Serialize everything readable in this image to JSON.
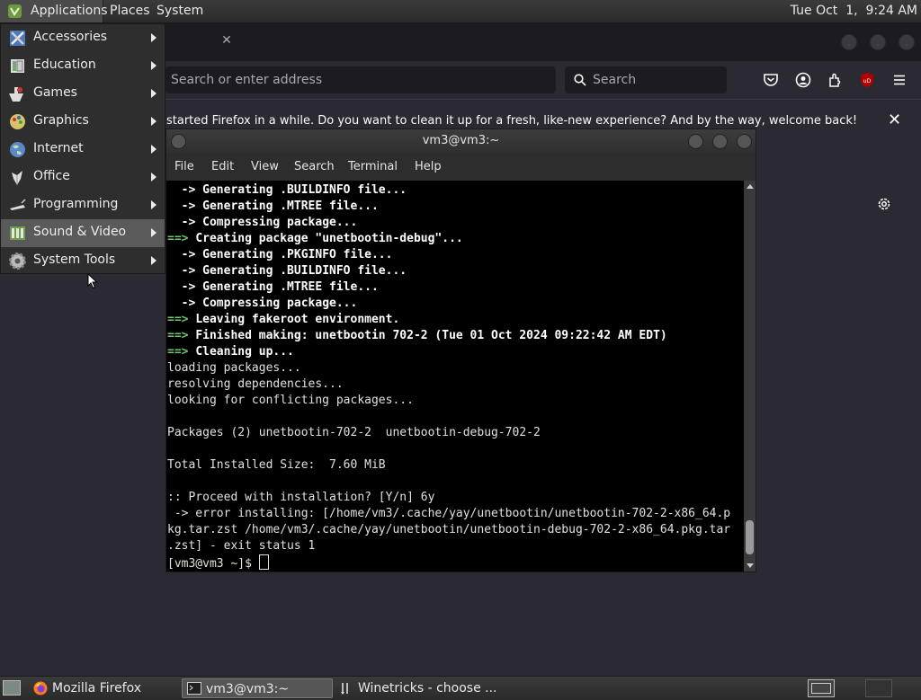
{
  "top_panel": {
    "applications_label": "Applications",
    "places_label": "Places",
    "system_label": "System",
    "clock": "Tue Oct  1,  9:24 AM"
  },
  "firefox": {
    "url_placeholder": "Search or enter address",
    "search_placeholder": "Search",
    "notification": "started Firefox in a while. Do you want to clean it up for a fresh, like-new experience? And by the way, welcome back!",
    "ublock_badge": "uD"
  },
  "apps_menu": {
    "items": [
      {
        "label": "Accessories",
        "icon": "accessories-icon"
      },
      {
        "label": "Education",
        "icon": "education-icon"
      },
      {
        "label": "Games",
        "icon": "games-icon"
      },
      {
        "label": "Graphics",
        "icon": "graphics-icon"
      },
      {
        "label": "Internet",
        "icon": "internet-icon"
      },
      {
        "label": "Office",
        "icon": "office-icon"
      },
      {
        "label": "Programming",
        "icon": "programming-icon"
      },
      {
        "label": "Sound & Video",
        "icon": "sound-video-icon"
      },
      {
        "label": "System Tools",
        "icon": "system-tools-icon"
      }
    ],
    "highlighted": "Sound & Video"
  },
  "terminal": {
    "title": "vm3@vm3:~",
    "menu": [
      "File",
      "Edit",
      "View",
      "Search",
      "Terminal",
      "Help"
    ],
    "lines": [
      {
        "p": "  -> ",
        "t": "Generating .BUILDINFO file..."
      },
      {
        "p": "  -> ",
        "t": "Generating .MTREE file..."
      },
      {
        "p": "  -> ",
        "t": "Compressing package..."
      },
      {
        "p": "==> ",
        "t": "Creating package \"unetbootin-debug\"..."
      },
      {
        "p": "  -> ",
        "t": "Generating .PKGINFO file..."
      },
      {
        "p": "  -> ",
        "t": "Generating .BUILDINFO file..."
      },
      {
        "p": "  -> ",
        "t": "Generating .MTREE file..."
      },
      {
        "p": "  -> ",
        "t": "Compressing package..."
      },
      {
        "p": "==> ",
        "t": "Leaving fakeroot environment."
      },
      {
        "p": "==> ",
        "t": "Finished making: unetbootin 702-2 (Tue 01 Oct 2024 09:22:42 AM EDT)"
      },
      {
        "p": "==> ",
        "t": "Cleaning up..."
      },
      {
        "p": "",
        "t": "loading packages..."
      },
      {
        "p": "",
        "t": "resolving dependencies..."
      },
      {
        "p": "",
        "t": "looking for conflicting packages..."
      },
      {
        "p": "",
        "t": ""
      },
      {
        "p": "",
        "t": "Packages (2) unetbootin-702-2  unetbootin-debug-702-2"
      },
      {
        "p": "",
        "t": ""
      },
      {
        "p": "",
        "t": "Total Installed Size:  7.60 MiB"
      },
      {
        "p": "",
        "t": ""
      },
      {
        "p": "",
        "t": ":: Proceed with installation? [Y/n] 6y"
      },
      {
        "p": "",
        "t": " -> error installing: [/home/vm3/.cache/yay/unetbootin/unetbootin-702-2-x86_64.p"
      },
      {
        "p": "",
        "t": "kg.tar.zst /home/vm3/.cache/yay/unetbootin/unetbootin-debug-702-2-x86_64.pkg.tar"
      },
      {
        "p": "",
        "t": ".zst] - exit status 1"
      }
    ],
    "prompt": "[vm3@vm3 ~]$ "
  },
  "taskbar": {
    "tasks": [
      "Mozilla Firefox",
      "vm3@vm3:~",
      "Winetricks - choose ..."
    ],
    "active_task": "vm3@vm3:~"
  }
}
